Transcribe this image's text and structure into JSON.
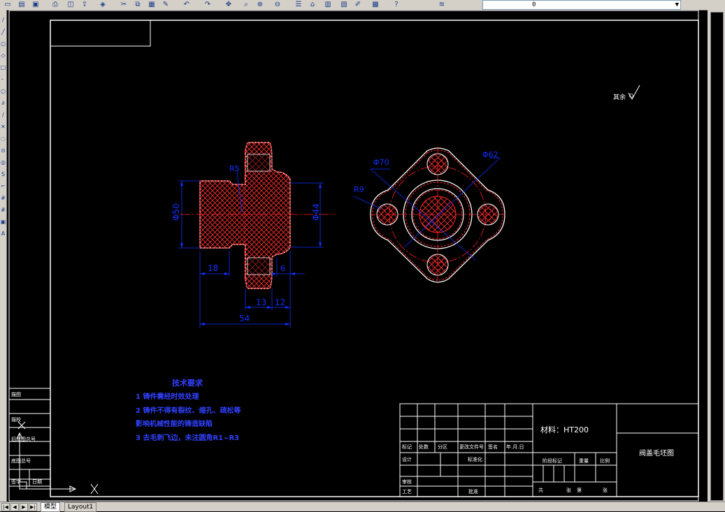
{
  "toolbar": {
    "icons": [
      "new-icon",
      "open-icon",
      "save-icon",
      "print-icon",
      "preview-icon",
      "publish-icon",
      "3d-icon",
      "cut-icon",
      "copy-icon",
      "paste-icon",
      "match-icon",
      "undo-icon",
      "redo-icon",
      "pan-icon",
      "zoom-realtime-icon",
      "zoom-window-icon",
      "zoom-previous-icon",
      "properties-icon",
      "design-center-icon",
      "tool-palette-icon",
      "sheet-set-icon",
      "markup-icon",
      "calculator-icon",
      "help-icon",
      "layer-manager-icon"
    ],
    "layer_value": "0"
  },
  "tabs": {
    "model": "模型",
    "layout": "Layout1"
  },
  "drawing": {
    "roughness_note": "其余",
    "dims": {
      "phi50_left": "Φ50",
      "phi44": "Φ44",
      "r5": "R5",
      "d18": "18",
      "d6": "6",
      "d13": "13",
      "d12": "12",
      "d54": "54",
      "phi70": "Φ70",
      "phi62": "Φ62",
      "r9": "R9"
    },
    "tech_req": {
      "title": "技术要求",
      "line1": "1   铸件需经时效处理",
      "line2": "2   铸件不得有裂纹、缩孔、疏松等",
      "line3": "   影响机械性能的铸造缺陷",
      "line4": "3   去毛刺飞边，未注圆角R1~R3"
    },
    "title_block": {
      "material": "材料：HT200",
      "drawing_name": "阀盖毛坯图",
      "mark": "标记",
      "count": "处数",
      "zone": "分区",
      "change_doc": "更改文件号",
      "signature": "签名",
      "date": "年.月.日",
      "design": "设计",
      "standardize": "标准化",
      "stage_mark": "阶段标记",
      "weight": "重量",
      "scale": "比例",
      "review": "审核",
      "process": "工艺",
      "approve": "批准",
      "total": "共",
      "sheet": "张",
      "page": "第",
      "page_sheet": "张"
    },
    "side_block": {
      "a": "描图",
      "b": "描校",
      "c": "旧底图总号",
      "d": "底图总号",
      "e": "签字",
      "f": "日期"
    },
    "ucs": {
      "y": "Y",
      "x": "X"
    }
  },
  "colors": {
    "background": "#000000",
    "frame": "#ffffff",
    "outline": "#ff0000",
    "dimension": "#1030ff",
    "center": "#ff2020",
    "hatch": "#ff3030",
    "ui": "#d4d0c8"
  }
}
